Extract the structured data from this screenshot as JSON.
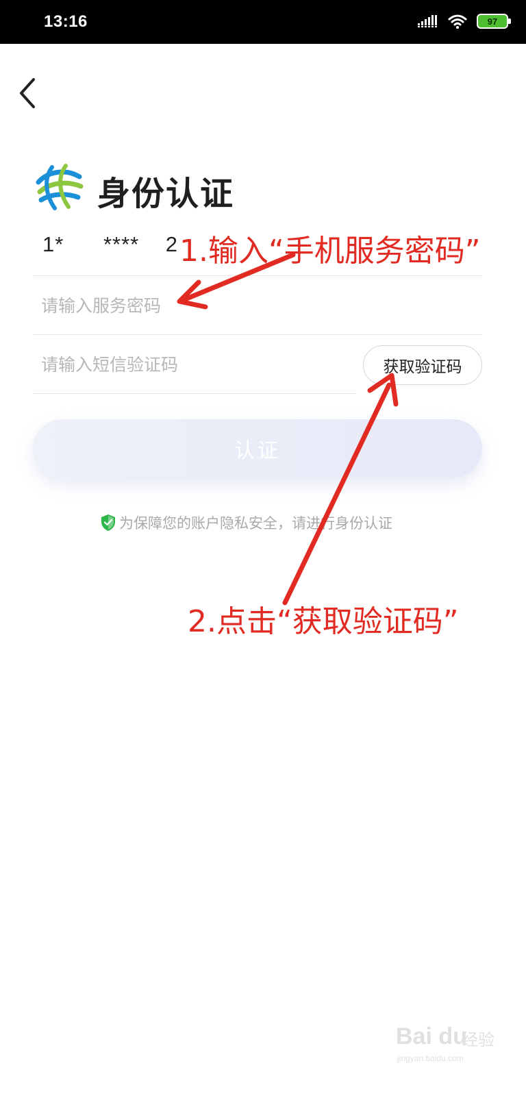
{
  "status_bar": {
    "time": "13:16",
    "battery": "97",
    "icons": [
      "signal-icon",
      "wifi-icon",
      "battery-icon"
    ]
  },
  "header": {
    "back_icon": "chevron-left-icon"
  },
  "title": {
    "logo_icon": "china-mobile-logo-icon",
    "text": "身份认证"
  },
  "form": {
    "phone_number": "1*      ****    2",
    "service_password_placeholder": "请输入服务密码",
    "sms_code_placeholder": "请输入短信验证码",
    "get_code_label": "获取验证码",
    "submit_label": "认证"
  },
  "notice": {
    "icon": "shield-check-icon",
    "text": "为保障您的账户隐私安全，请进行身份认证"
  },
  "annotations": {
    "step1": "1.输入“手机服务密码”",
    "step2": "2.点击“获取验证码”",
    "color": "#e12a22"
  },
  "watermark": {
    "brand": "Bai du",
    "brand_suffix": "经验",
    "url": "jingyan.baidu.com"
  },
  "colors": {
    "annotation_red": "#e12a22",
    "shield_green": "#2fb64a",
    "logo_blue": "#1b8fd8",
    "logo_green": "#8dc63f"
  }
}
